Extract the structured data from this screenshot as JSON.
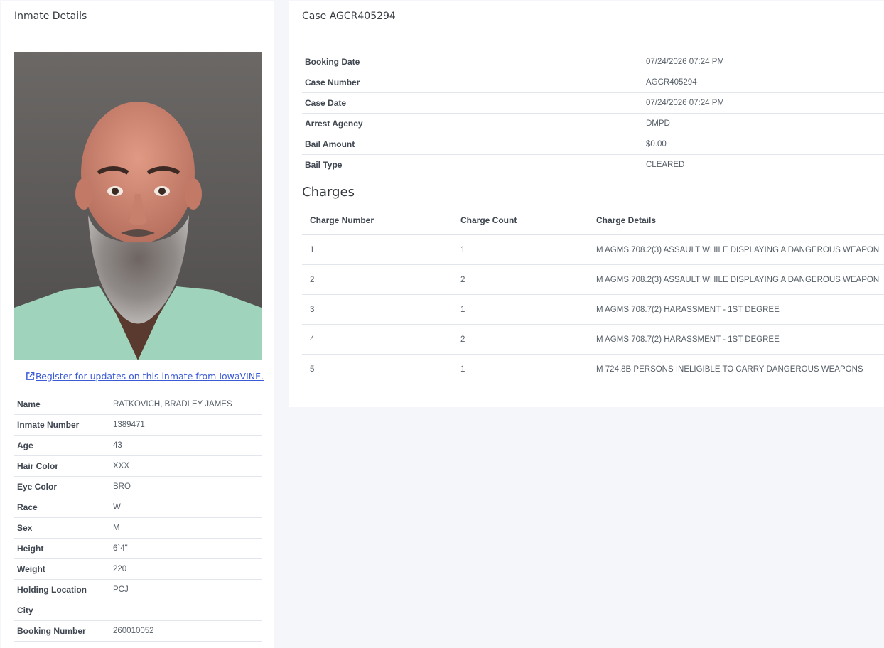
{
  "left": {
    "title": "Inmate Details",
    "vine_link": "Register for updates on this inmate from IowaVINE.",
    "details": [
      {
        "label": "Name",
        "value": "RATKOVICH, BRADLEY JAMES"
      },
      {
        "label": "Inmate Number",
        "value": "1389471"
      },
      {
        "label": "Age",
        "value": "43"
      },
      {
        "label": "Hair Color",
        "value": "XXX"
      },
      {
        "label": "Eye Color",
        "value": "BRO"
      },
      {
        "label": "Race",
        "value": "W"
      },
      {
        "label": "Sex",
        "value": "M"
      },
      {
        "label": "Height",
        "value": "6`4\""
      },
      {
        "label": "Weight",
        "value": "220"
      },
      {
        "label": "Holding Location",
        "value": "PCJ"
      },
      {
        "label": "City",
        "value": ""
      },
      {
        "label": "Booking Number",
        "value": "260010052"
      }
    ]
  },
  "right": {
    "title": "Case AGCR405294",
    "case_details": [
      {
        "label": "Booking Date",
        "value": "07/24/2026 07:24 PM"
      },
      {
        "label": "Case Number",
        "value": "AGCR405294"
      },
      {
        "label": "Case Date",
        "value": "07/24/2026 07:24 PM"
      },
      {
        "label": "Arrest Agency",
        "value": "DMPD"
      },
      {
        "label": "Bail Amount",
        "value": "$0.00"
      },
      {
        "label": "Bail Type",
        "value": "CLEARED"
      }
    ],
    "charges_heading": "Charges",
    "charges_columns": [
      "Charge Number",
      "Charge Count",
      "Charge Details"
    ],
    "charges": [
      {
        "number": "1",
        "count": "1",
        "details": "M AGMS 708.2(3) ASSAULT WHILE DISPLAYING A DANGEROUS WEAPON"
      },
      {
        "number": "2",
        "count": "2",
        "details": "M AGMS 708.2(3) ASSAULT WHILE DISPLAYING A DANGEROUS WEAPON"
      },
      {
        "number": "3",
        "count": "1",
        "details": "M AGMS 708.7(2) HARASSMENT - 1ST DEGREE"
      },
      {
        "number": "4",
        "count": "2",
        "details": "M AGMS 708.7(2) HARASSMENT - 1ST DEGREE"
      },
      {
        "number": "5",
        "count": "1",
        "details": "M 724.8B PERSONS INELIGIBLE TO CARRY DANGEROUS WEAPONS"
      }
    ]
  },
  "colors": {
    "page_background": "#f5f6fa",
    "panel": "#ffffff",
    "link": "#3b5bd6"
  },
  "icons": {
    "vine_link_icon": "external-link-icon"
  }
}
